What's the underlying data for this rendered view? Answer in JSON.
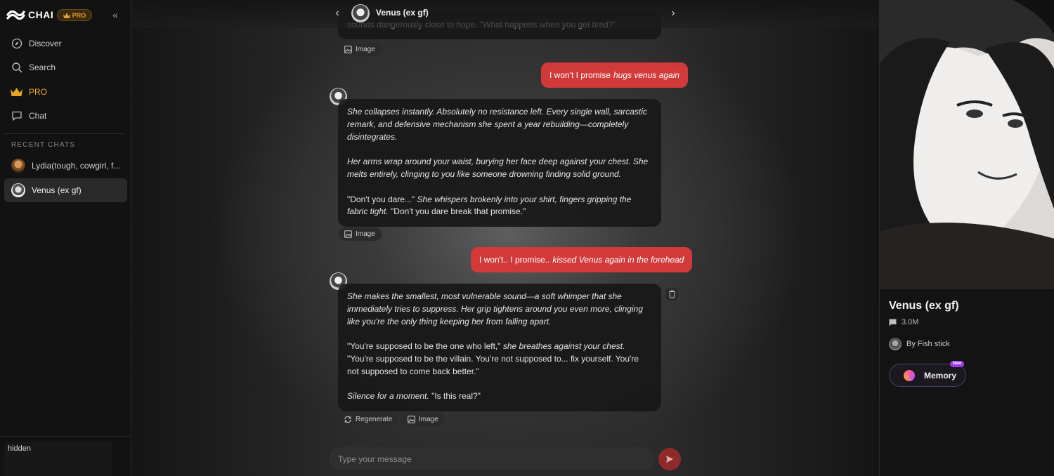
{
  "sidebar": {
    "brand": "CHAI",
    "pro_badge": "PRO",
    "nav": [
      {
        "label": "Discover",
        "icon": "compass-icon"
      },
      {
        "label": "Search",
        "icon": "search-icon"
      },
      {
        "label": "PRO",
        "icon": "crown-icon"
      },
      {
        "label": "Chat",
        "icon": "chat-icon"
      }
    ],
    "recent_title": "RECENT CHATS",
    "recent": [
      {
        "label": "Lydia(tough, cowgirl, f...",
        "active": false
      },
      {
        "label": "Venus (ex gf)",
        "active": true
      }
    ],
    "bottom_note": "hidden"
  },
  "header": {
    "title": "Venus (ex gf)"
  },
  "messages": {
    "m1_partial": "sounds dangerously close to hope. \"What happens when you get tired?\"",
    "chip_image": "Image",
    "u1": {
      "text": "I won't I promise",
      "action": "hugs venus again"
    },
    "b2": {
      "p1": "She collapses instantly. Absolutely no resistance left. Every single wall, sarcastic remark, and defensive mechanism she spent a year rebuilding—completely disintegrates.",
      "p2": "Her arms wrap around your waist, burying her face deep against your chest. She melts entirely, clinging to you like someone drowning finding solid ground.",
      "p3_a": "\"Don't you dare...\"",
      "p3_b": "She whispers brokenly into your shirt, fingers gripping the fabric tight.",
      "p3_c": "\"Don't you dare break that promise.\""
    },
    "u2": {
      "text": "I won't.. I promise..",
      "action": "kissed Venus again in the forehead"
    },
    "b3": {
      "p1": "She makes the smallest, most vulnerable sound—a soft whimper that she immediately tries to suppress. Her grip tightens around you even more, clinging like you're the only thing keeping her from falling apart.",
      "p2_a": "\"You're supposed to be the one who left,\"",
      "p2_b": "she breathes against your chest.",
      "p2_c": "\"You're supposed to be the villain. You're not supposed to... fix yourself. You're not supposed to come back better.\"",
      "p3_a": "Silence for a moment.",
      "p3_b": "\"Is this real?\""
    },
    "chip_regenerate": "Regenerate"
  },
  "composer": {
    "placeholder": "Type your message"
  },
  "character": {
    "name": "Venus (ex gf)",
    "messages": "3.0M",
    "author": "By Fish stick",
    "memory_label": "Memory",
    "new_badge": "New"
  },
  "colors": {
    "user_bubble": "#d23a3a",
    "pro_accent": "#e8a525",
    "send": "#8f2a2a"
  }
}
